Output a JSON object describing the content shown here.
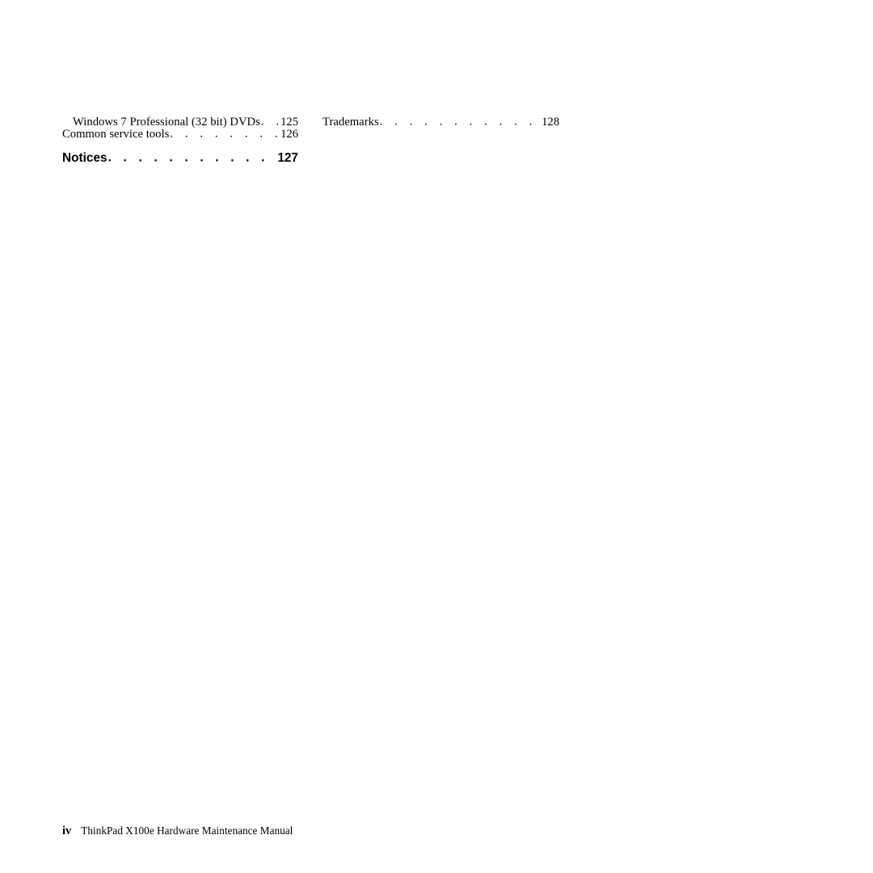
{
  "document": {
    "type": "table-of-contents-continuation",
    "page_folio": "iv",
    "footer_title": "ThinkPad X100e Hardware Maintenance Manual"
  },
  "toc": {
    "left_column": [
      {
        "label": "Windows 7 Professional (32 bit) DVDs",
        "page": "125",
        "level": 1,
        "style": "normal",
        "dots": ". . . . ."
      },
      {
        "label": "Common service tools",
        "page": "126",
        "level": 0,
        "style": "normal",
        "dots": ". . . . . . . . . . ."
      },
      {
        "label": "Notices",
        "page": "127",
        "level": 0,
        "style": "heading",
        "dots": ". . . . . . . . . . . . . ."
      }
    ],
    "right_column": [
      {
        "label": "Trademarks",
        "page": "128",
        "level": 0,
        "style": "normal",
        "dots": ". . . . . . . . . . . . . ."
      }
    ]
  }
}
